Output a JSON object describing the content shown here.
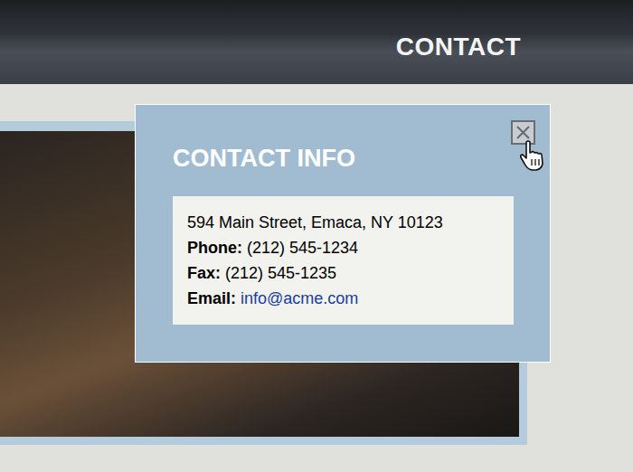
{
  "header": {
    "nav": "CONTACT"
  },
  "popup": {
    "title": "CONTACT INFO",
    "address": "594 Main Street, Emaca, NY 10123",
    "rows": [
      {
        "label": "Phone:",
        "value": "(212) 545-1234",
        "kind": "text"
      },
      {
        "label": "Fax:",
        "value": "(212) 545-1235",
        "kind": "text"
      },
      {
        "label": "Email:",
        "value": "info@acme.com",
        "kind": "link"
      }
    ]
  }
}
